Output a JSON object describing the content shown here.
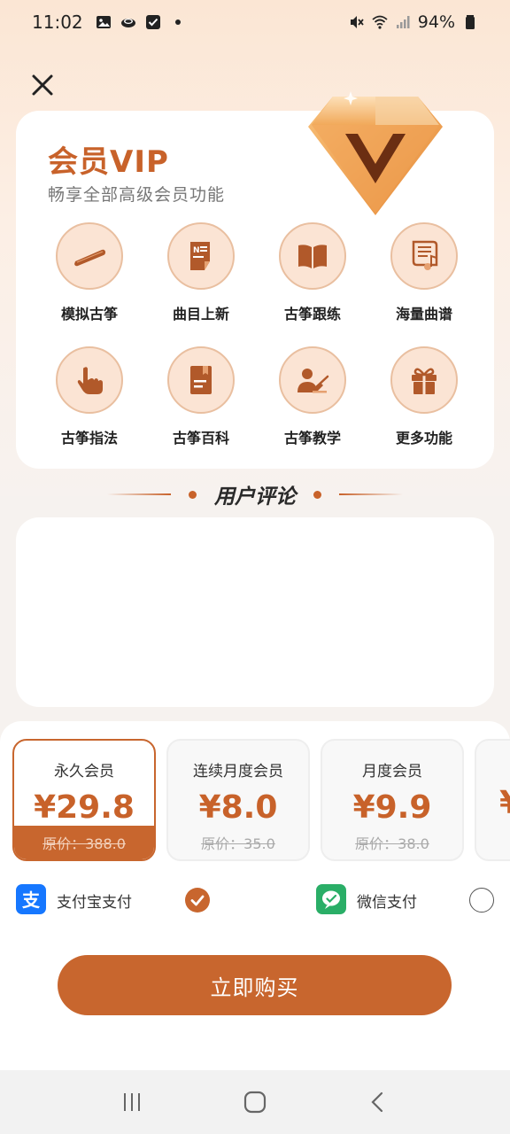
{
  "status_bar": {
    "time": "11:02",
    "battery": "94%",
    "left_icons": [
      "gallery-icon",
      "cloud-icon",
      "check-box-icon",
      "dot-icon"
    ],
    "right_icons": [
      "mute-icon",
      "wifi-icon",
      "signal-icon",
      "battery-icon"
    ]
  },
  "header": {
    "close_icon": "close-icon"
  },
  "vip": {
    "title": "会员VIP",
    "subtitle": "畅享全部高级会员功能",
    "badge_icon": "diamond-v-icon",
    "features": [
      {
        "label": "模拟古筝",
        "icon": "guzheng-icon"
      },
      {
        "label": "曲目上新",
        "icon": "new-track-icon"
      },
      {
        "label": "古筝跟练",
        "icon": "book-icon"
      },
      {
        "label": "海量曲谱",
        "icon": "sheet-music-icon"
      },
      {
        "label": "古筝指法",
        "icon": "finger-icon"
      },
      {
        "label": "古筝百科",
        "icon": "encyclopedia-icon"
      },
      {
        "label": "古筝教学",
        "icon": "teacher-icon"
      },
      {
        "label": "更多功能",
        "icon": "gift-icon"
      }
    ]
  },
  "reviews": {
    "title": "用户评论"
  },
  "plans": [
    {
      "name": "永久会员",
      "price": "¥29.8",
      "original": "原价：388.0",
      "selected": true
    },
    {
      "name": "连续月度会员",
      "price": "¥8.0",
      "original": "原价：35.0",
      "selected": false
    },
    {
      "name": "月度会员",
      "price": "¥9.9",
      "original": "原价：38.0",
      "selected": false
    },
    {
      "name": "",
      "price": "¥",
      "original": "",
      "selected": false
    }
  ],
  "payment": {
    "alipay_label": "支付宝支付",
    "alipay_selected": true,
    "wechat_label": "微信支付",
    "wechat_selected": false,
    "colors": {
      "alipay": "#1677ff",
      "wechat": "#2aae67"
    }
  },
  "buy_button": "立即购买",
  "colors": {
    "accent": "#c8662e"
  },
  "nav_bar": {
    "icons": [
      "recent-apps-icon",
      "home-icon",
      "back-icon"
    ]
  }
}
